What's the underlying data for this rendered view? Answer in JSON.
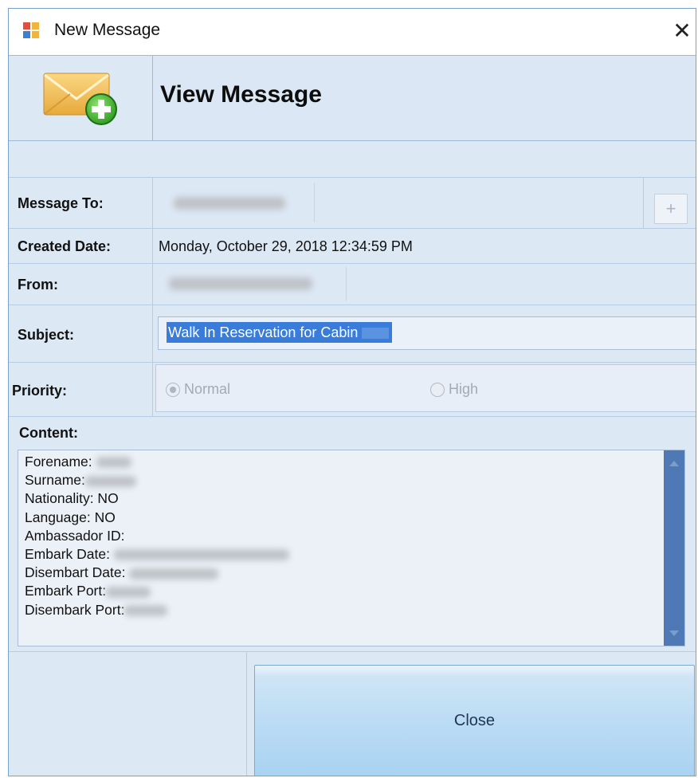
{
  "window": {
    "title": "New Message",
    "close_glyph": "✕"
  },
  "header": {
    "title": "View Message",
    "icon": "mail-add-icon"
  },
  "fields": {
    "message_to": {
      "label": "Message To:",
      "add_glyph": "+"
    },
    "created_date": {
      "label": "Created Date:",
      "value": "Monday, October 29, 2018 12:34:59 PM"
    },
    "from": {
      "label": "From:"
    },
    "subject": {
      "label": "Subject:",
      "value": "Walk In Reservation for Cabin"
    },
    "priority": {
      "label": "Priority:",
      "options": [
        "Normal",
        "High"
      ],
      "selected": "Normal"
    }
  },
  "content": {
    "label": "Content:",
    "lines": [
      "Forename:",
      "Surname:",
      "Nationality: NO",
      "Language: NO",
      "Ambassador ID:",
      "Embark Date:",
      "Disembart Date:",
      "Embark Port:",
      "Disembark Port:"
    ]
  },
  "buttons": {
    "close": "Close"
  },
  "colors": {
    "accent": "#3a7cd9",
    "panel": "#dde8f5",
    "scrollbar": "#4f79b4"
  }
}
